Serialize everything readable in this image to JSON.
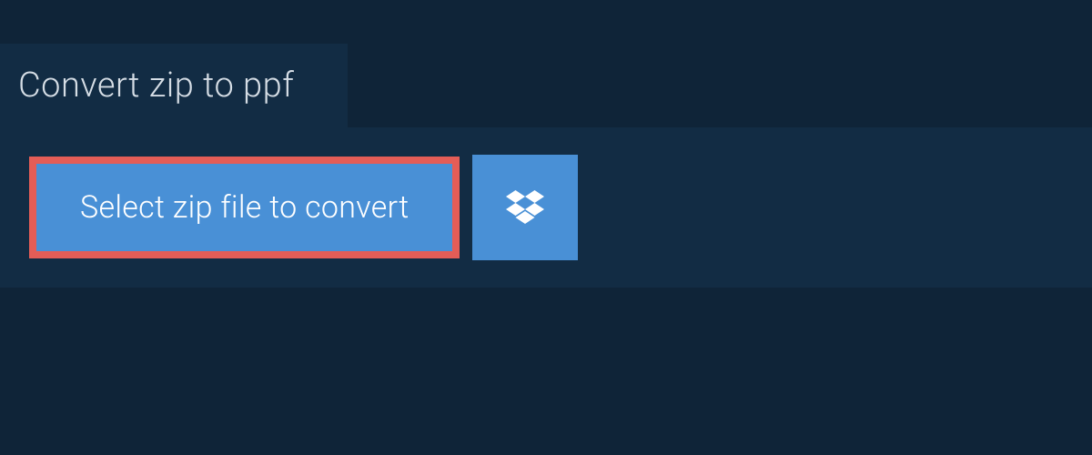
{
  "header": {
    "title": "Convert zip to ppf"
  },
  "actions": {
    "select_file_label": "Select zip file to convert"
  },
  "colors": {
    "background": "#0f2438",
    "panel": "#122c44",
    "button": "#4990d6",
    "highlight_border": "#e45d57",
    "text_light": "#d5dde5",
    "text_white": "#ffffff"
  }
}
